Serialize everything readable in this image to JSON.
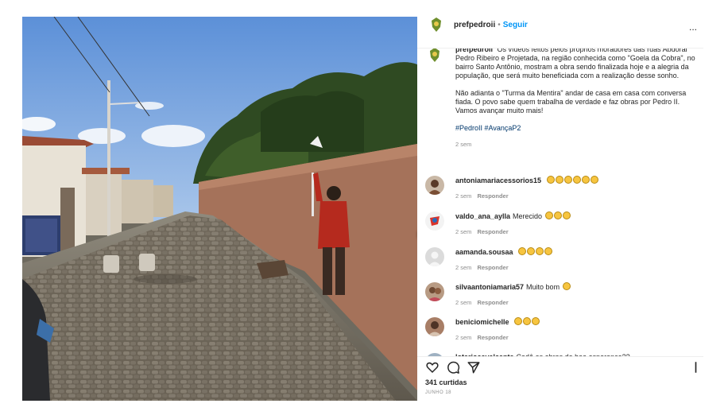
{
  "header": {
    "username": "prefpedroii",
    "separator": "•",
    "follow_label": "Seguir",
    "more_label": "..."
  },
  "caption": {
    "username": "prefpedroii",
    "paragraph1": "Os vídeos feitos pelos próprios moradores das ruas Abdoral Pedro Ribeiro e Projetada, na região conhecida como \"Goela da Cobra\", no bairro Santo Antônio, mostram a obra sendo finalizada hoje e a alegria da população, que será muito beneficiada com a realização desse sonho.",
    "paragraph2": "Não adianta o \"Turma da Mentira\" andar de casa em casa com conversa fiada. O povo sabe quem trabalha de verdade e faz obras por Pedro II. Vamos avançar muito mais!",
    "hashtags": "#PedroII #AvançaP2",
    "time": "2 sem"
  },
  "comments": [
    {
      "username": "antoniamariacessorios15",
      "text": "",
      "emoji_count": 6,
      "time": "2 sem",
      "reply": "Responder"
    },
    {
      "username": "valdo_ana_aylla",
      "text": "Merecido",
      "emoji_count": 3,
      "time": "2 sem",
      "reply": "Responder"
    },
    {
      "username": "aamanda.sousaa",
      "text": "",
      "emoji_count": 4,
      "time": "2 sem",
      "reply": "Responder"
    },
    {
      "username": "silvaantoniamaria57",
      "text": "Muito bom",
      "emoji_count": 1,
      "time": "2 sem",
      "reply": "Responder"
    },
    {
      "username": "beniciomichelle",
      "text": "",
      "emoji_count": 3,
      "time": "2 sem",
      "reply": "Responder"
    },
    {
      "username": "lotariocavalcante",
      "text": "Cadê as obras do boa esperança??",
      "emoji_count": 0,
      "time": "",
      "reply": ""
    }
  ],
  "footer": {
    "likes": "341 curtidas",
    "date": "JUNHO 18"
  },
  "icons": [
    "like-heart-icon",
    "comment-bubble-icon",
    "share-plane-icon",
    "save-bookmark-icon",
    "next-arrow-icon"
  ],
  "colors": {
    "link": "#0095f6",
    "hashtag": "#00376b",
    "muted": "#8e8e8e",
    "text": "#262626"
  }
}
